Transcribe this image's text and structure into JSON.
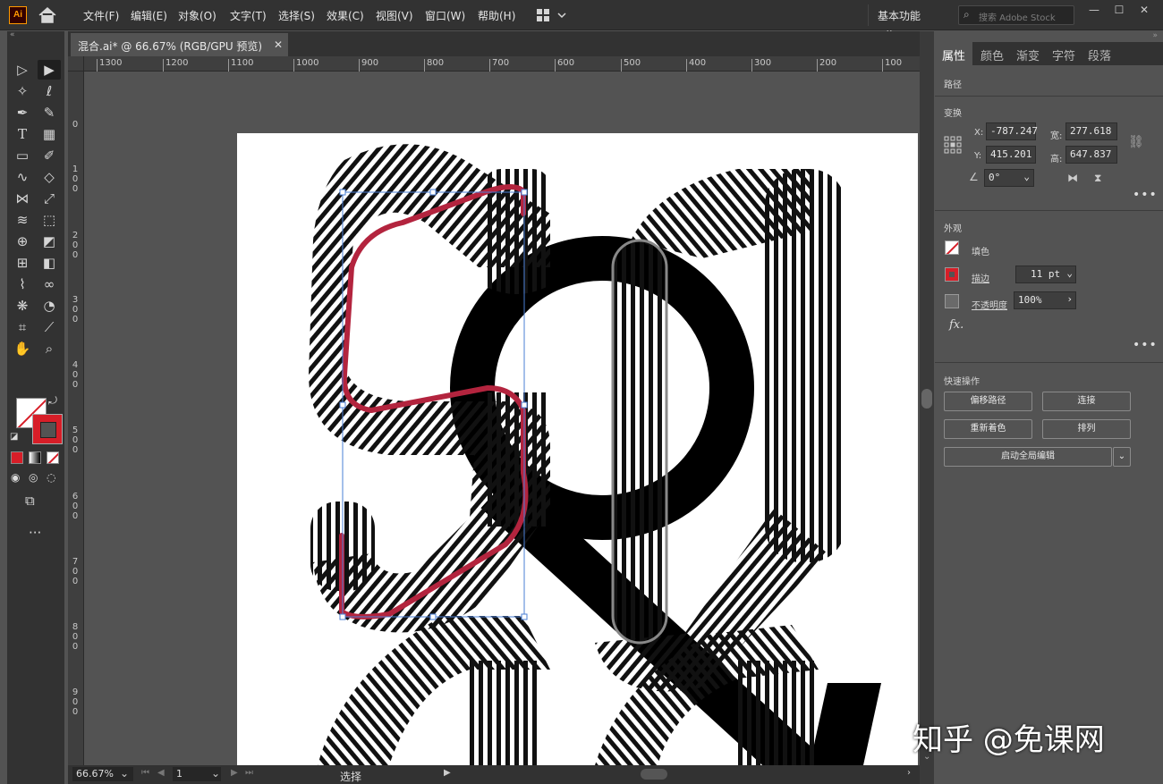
{
  "app": {
    "logo": "Ai",
    "menu": [
      "文件(F)",
      "编辑(E)",
      "对象(O)",
      "文字(T)",
      "选择(S)",
      "效果(C)",
      "视图(V)",
      "窗口(W)",
      "帮助(H)"
    ],
    "workspace": "基本功能",
    "search_placeholder": "搜索 Adobe Stock"
  },
  "document": {
    "tab_title": "混合.ai* @ 66.67% (RGB/GPU 预览)"
  },
  "ruler": {
    "horizontal": [
      "1300",
      "1200",
      "1100",
      "1000",
      "900",
      "800",
      "700",
      "600",
      "500",
      "400",
      "300",
      "200",
      "100"
    ],
    "vertical": [
      "0",
      "100",
      "200",
      "300",
      "400",
      "500",
      "600",
      "700",
      "800",
      "900"
    ]
  },
  "status": {
    "zoom": "66.67%",
    "page": "1",
    "tool": "选择"
  },
  "panel": {
    "tabs": [
      "属性",
      "颜色",
      "渐变",
      "字符",
      "段落"
    ],
    "active_tab": "属性",
    "object_type": "路径",
    "transform": {
      "title": "变换",
      "x_label": "X:",
      "x": "-787.247",
      "y_label": "Y:",
      "y": "415.201",
      "w_label": "宽:",
      "w": "277.618",
      "h_label": "高:",
      "h": "647.837",
      "angle": "0°"
    },
    "appearance": {
      "title": "外观",
      "fill_label": "填色",
      "stroke_label": "描边",
      "stroke_weight": "11 pt",
      "opacity_label": "不透明度",
      "opacity": "100%",
      "fx": "fx."
    },
    "quick_actions": {
      "title": "快速操作",
      "offset_path": "偏移路径",
      "join": "连接",
      "recolor": "重新着色",
      "arrange": "排列",
      "global_edit": "启动全局编辑"
    }
  },
  "colors": {
    "stroke_accent": "#d71e28",
    "selection": "#4a7fd6",
    "path_highlight": "#b3243e"
  },
  "watermark": "知乎 @免课网"
}
